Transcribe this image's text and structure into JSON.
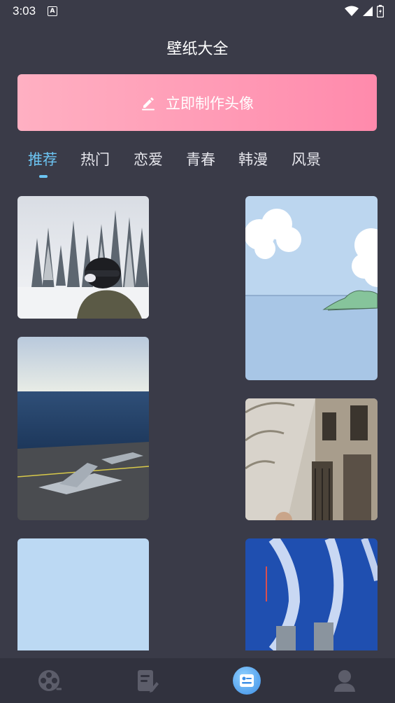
{
  "status_bar": {
    "time": "3:03",
    "notification_icon": "A"
  },
  "header": {
    "title": "壁纸大全"
  },
  "banner": {
    "label": "立即制作头像",
    "icon": "edit-pencil-icon"
  },
  "tabs": [
    {
      "label": "推荐",
      "active": true
    },
    {
      "label": "热门",
      "active": false
    },
    {
      "label": "恋爱",
      "active": false
    },
    {
      "label": "青春",
      "active": false
    },
    {
      "label": "韩漫",
      "active": false
    },
    {
      "label": "风景",
      "active": false
    }
  ],
  "wallpapers": [
    {
      "subject": "snowy forest with skier helmet",
      "column": "left"
    },
    {
      "subject": "ocean and aircraft carrier deck",
      "column": "left"
    },
    {
      "subject": "light blue plain",
      "column": "left"
    },
    {
      "subject": "cartoon sky sea island",
      "column": "right"
    },
    {
      "subject": "arched building facade",
      "column": "right"
    },
    {
      "subject": "navy ships on blue sea",
      "column": "right"
    }
  ],
  "bottom_nav": [
    {
      "name": "film-reel-icon",
      "active": false
    },
    {
      "name": "document-edit-icon",
      "active": false
    },
    {
      "name": "wallpaper-icon",
      "active": true
    },
    {
      "name": "profile-icon",
      "active": false
    }
  ],
  "colors": {
    "background": "#3a3b48",
    "accent": "#6cc4f2",
    "banner_start": "#ffb0c2",
    "banner_end": "#ff8aac",
    "nav_bg": "#31323e"
  }
}
